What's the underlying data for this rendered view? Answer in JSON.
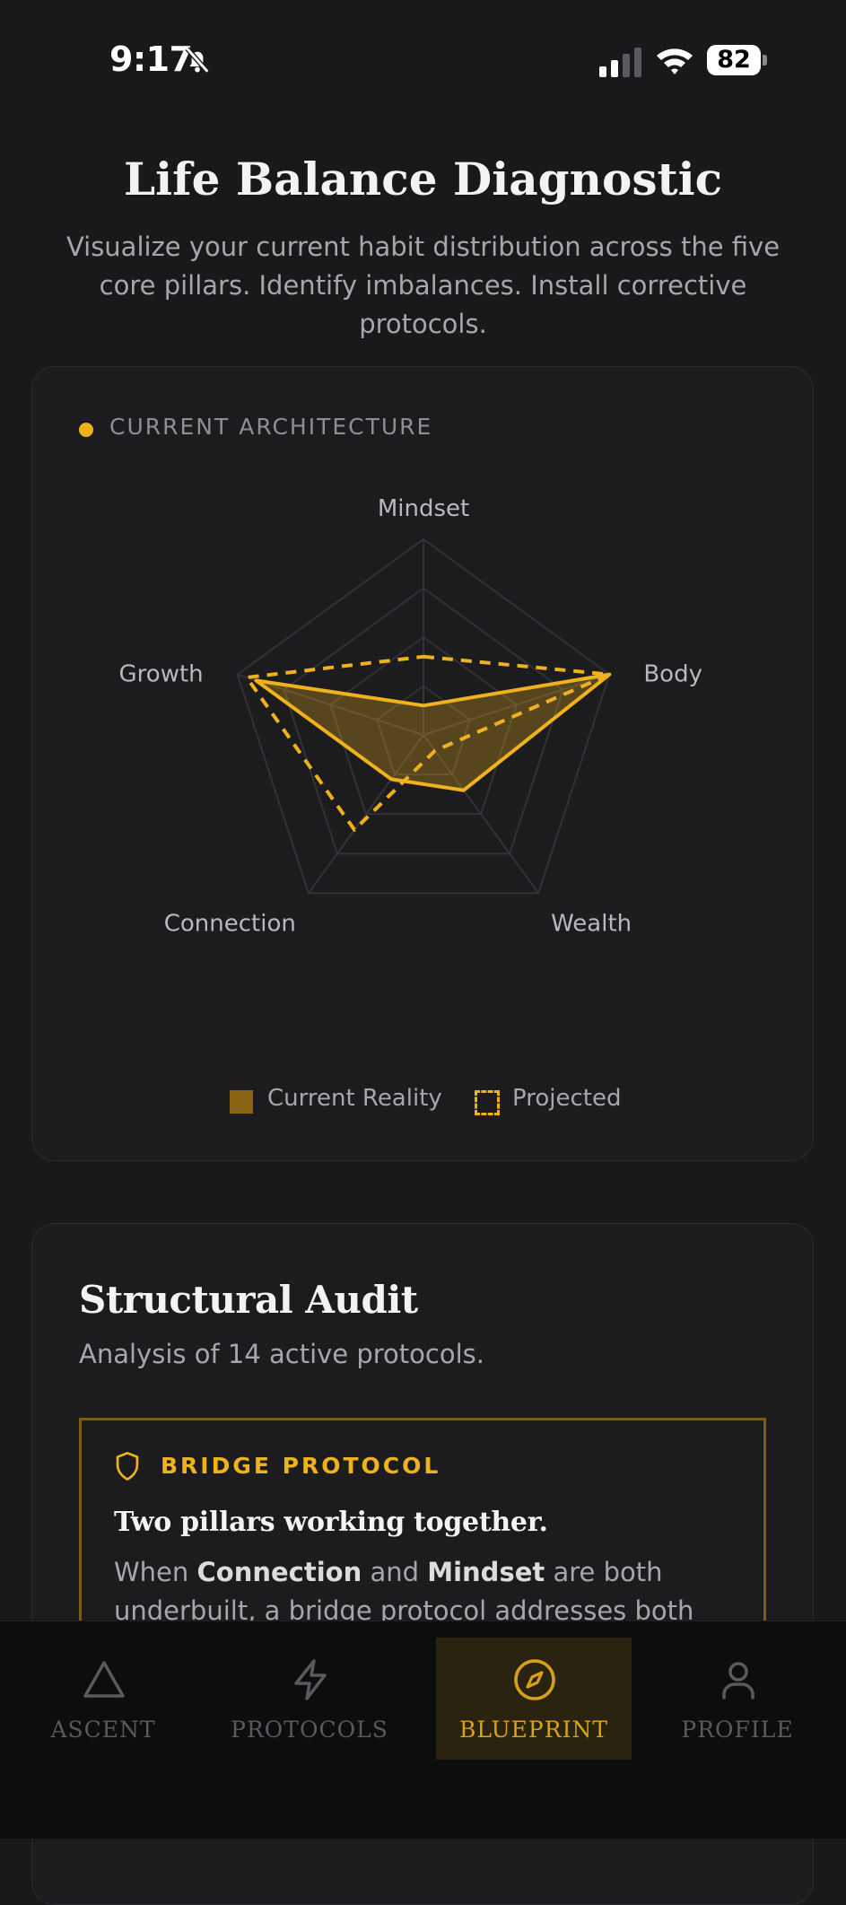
{
  "status_bar": {
    "time": "9:17",
    "battery": "82"
  },
  "header": {
    "title": "Life Balance Diagnostic",
    "subtitle": "Visualize your current habit distribution across the five core pillars. Identify imbalances. Install corrective protocols."
  },
  "architecture_card": {
    "label": "CURRENT ARCHITECTURE",
    "legend": {
      "current": "Current Reality",
      "projected": "Projected"
    }
  },
  "chart_data": {
    "type": "radar",
    "axes": [
      "Mindset",
      "Body",
      "Wealth",
      "Connection",
      "Growth"
    ],
    "rlim": [
      0,
      100
    ],
    "rings": 4,
    "series": [
      {
        "name": "Current Reality",
        "values": [
          15,
          100,
          35,
          28,
          90
        ],
        "style": "solid-filled"
      },
      {
        "name": "Projected",
        "values": [
          40,
          100,
          10,
          60,
          95
        ],
        "style": "dashed"
      }
    ],
    "accent_color": "#f0b21a",
    "grid": true
  },
  "audit_card": {
    "title": "Structural Audit",
    "subtitle": "Analysis of 14 active protocols.",
    "bridge": {
      "label": "BRIDGE PROTOCOL",
      "headline": "Two pillars working together.",
      "text_pre": "When ",
      "pillar_a": "Connection",
      "text_mid": " and ",
      "pillar_b": "Mindset",
      "text_post": " are both underbuilt, a bridge protocol addresses both"
    }
  },
  "tabs": [
    {
      "label": "ASCENT",
      "icon": "triangle-icon",
      "active": false
    },
    {
      "label": "PROTOCOLS",
      "icon": "lightning-icon",
      "active": false
    },
    {
      "label": "BLUEPRINT",
      "icon": "compass-icon",
      "active": true
    },
    {
      "label": "PROFILE",
      "icon": "person-icon",
      "active": false
    }
  ]
}
